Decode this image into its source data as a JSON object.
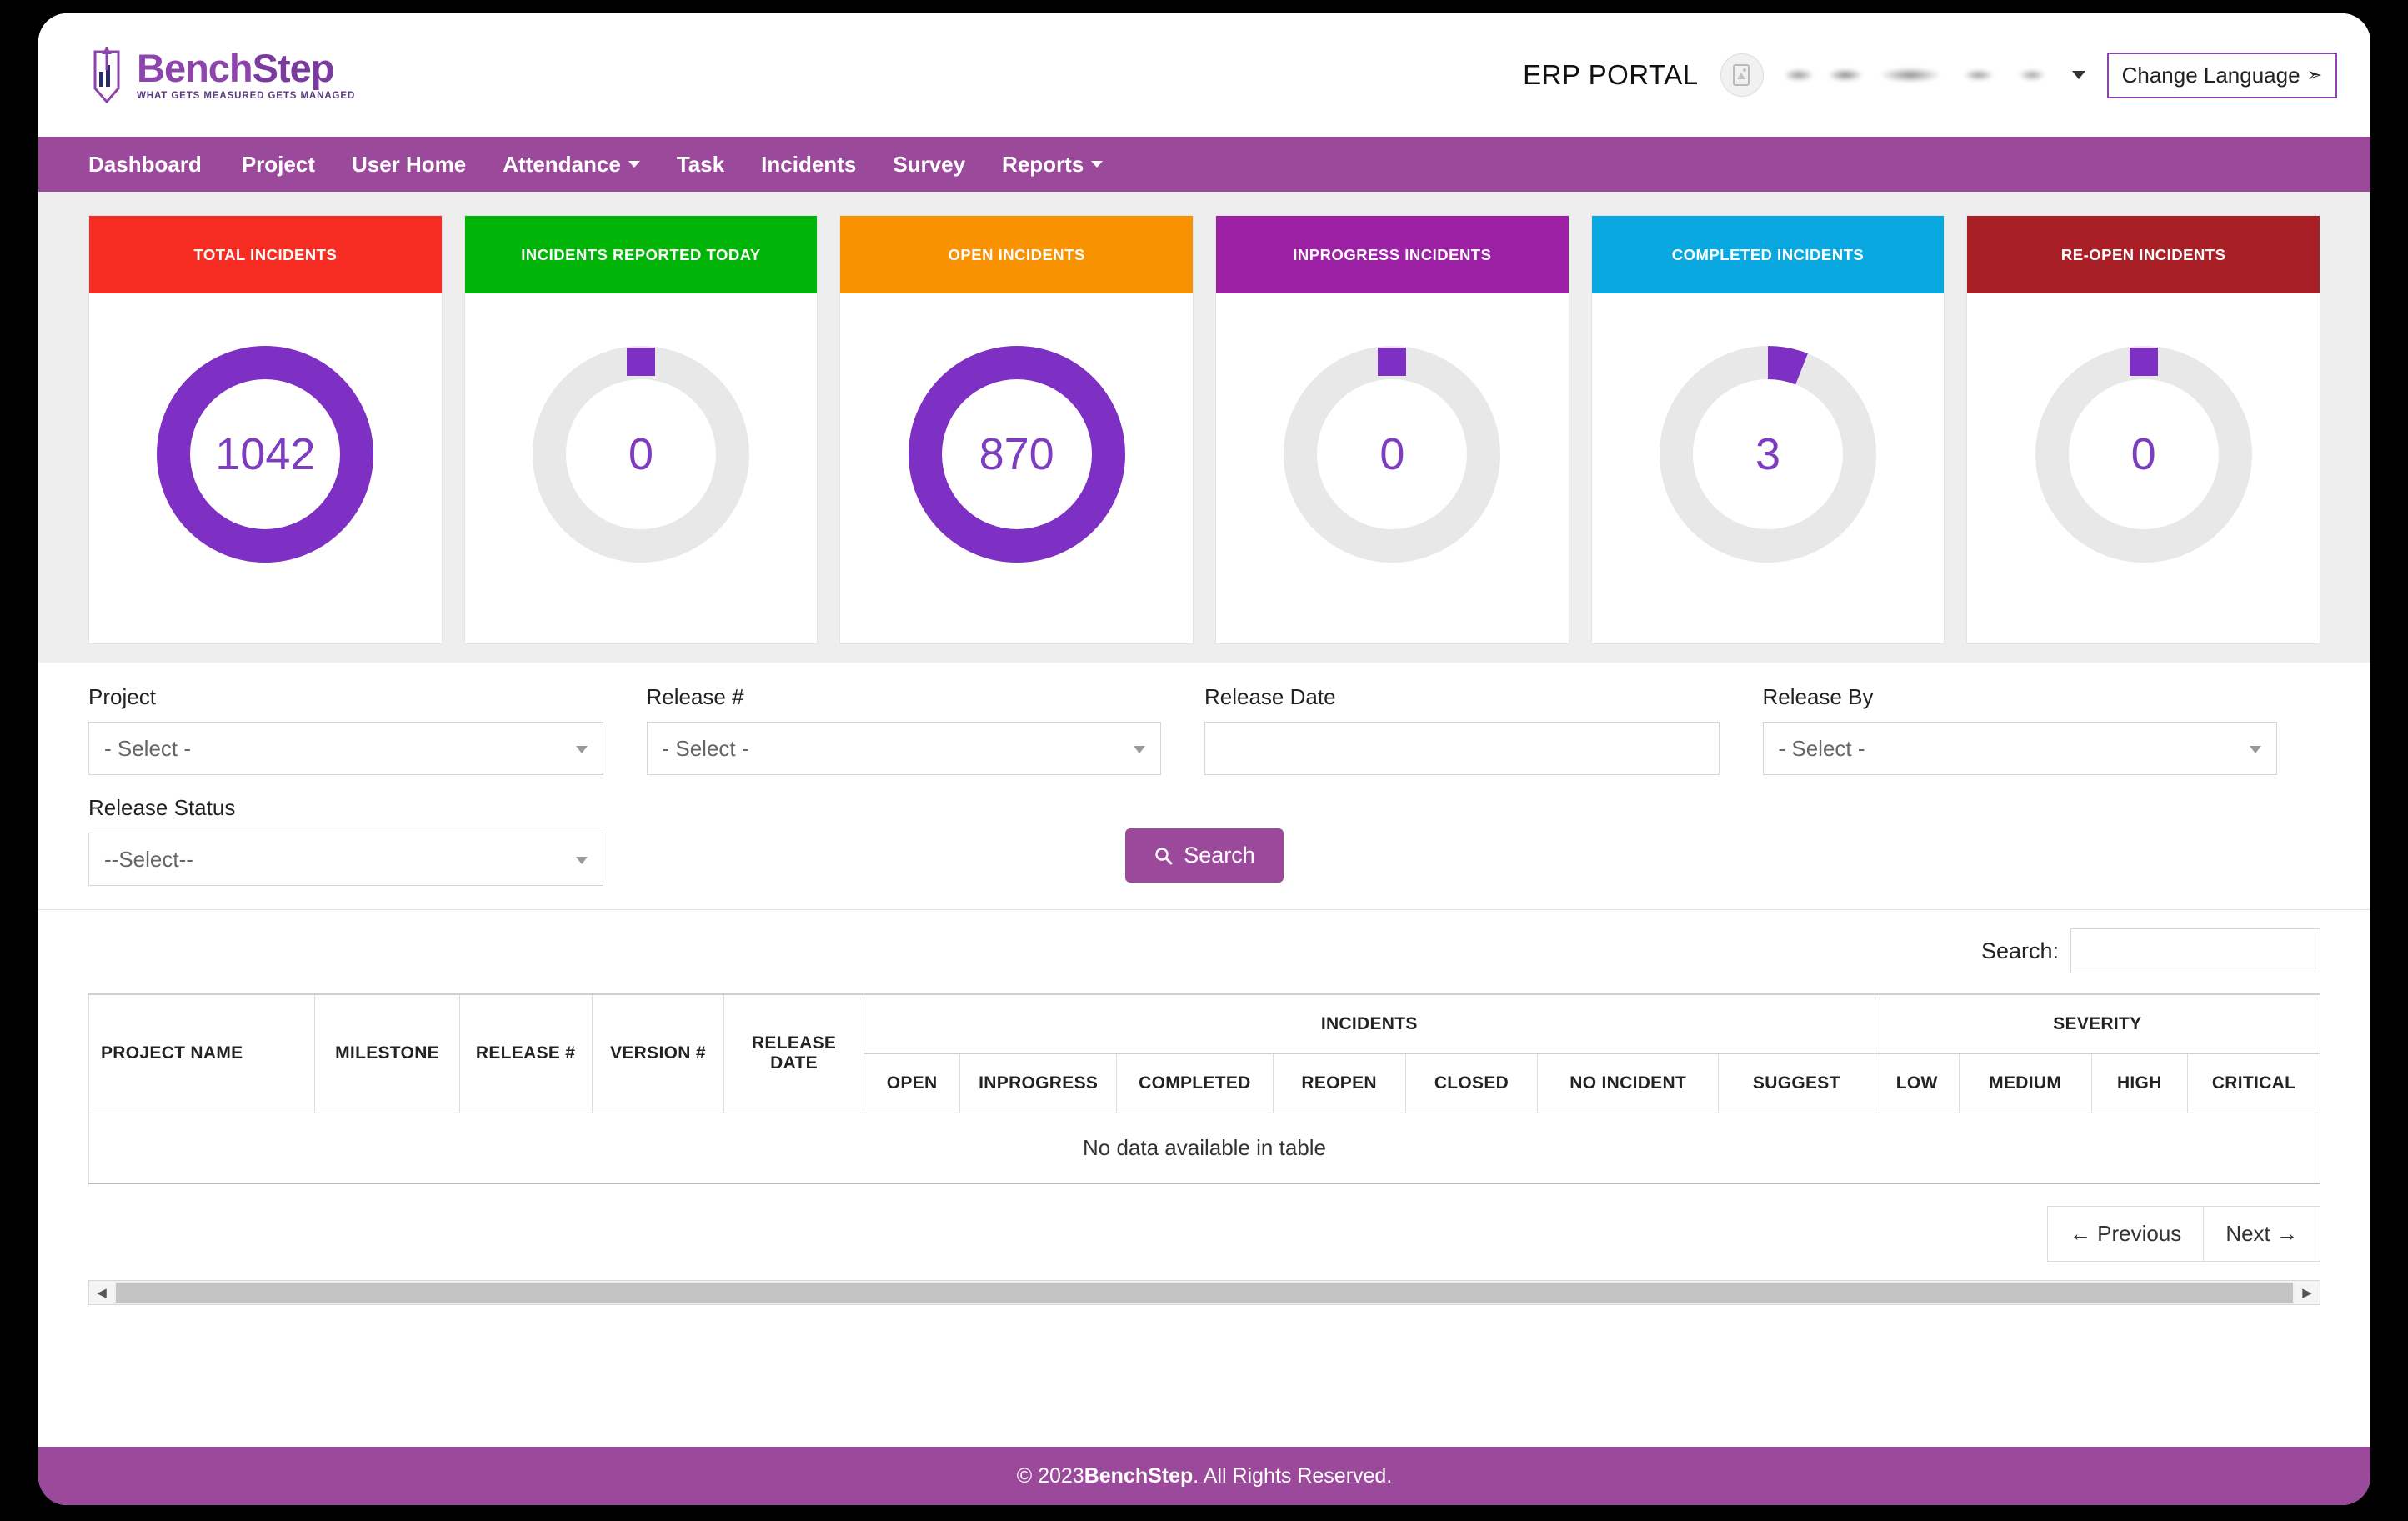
{
  "brand": {
    "name_part1": "Bench",
    "name_part2": "Step",
    "tagline": "WHAT GETS MEASURED GETS MANAGED",
    "logo_icon": "bar-chart-pen-logo-icon"
  },
  "header": {
    "portal_title": "ERP PORTAL",
    "avatar_icon": "user-avatar-icon",
    "user_email": "",
    "user_dropdown_icon": "caret-down-icon",
    "change_language_label": "Change Language",
    "change_language_chevron": "chevron-down-icon",
    "accent_color": "#8e44ad"
  },
  "nav": {
    "background": "#9b4a9b",
    "items": [
      {
        "label": "Dashboard",
        "has_caret": false
      },
      {
        "label": "Project",
        "has_caret": false
      },
      {
        "label": "User Home",
        "has_caret": false
      },
      {
        "label": "Attendance",
        "has_caret": true
      },
      {
        "label": "Task",
        "has_caret": false
      },
      {
        "label": "Incidents",
        "has_caret": false
      },
      {
        "label": "Survey",
        "has_caret": false
      },
      {
        "label": "Reports",
        "has_caret": true
      }
    ]
  },
  "chart_data": {
    "type": "pie",
    "title": "Incident KPI Donuts",
    "legend": "none",
    "ring_track_color": "#e8e8e8",
    "ring_value_color": "#7e2fc4",
    "cards": [
      {
        "label": "TOTAL INCIDENTS",
        "value": 1042,
        "percent": 100,
        "header_color": "#f72c22"
      },
      {
        "label": "INCIDENTS REPORTED TODAY",
        "value": 0,
        "percent": 0,
        "header_color": "#00b408"
      },
      {
        "label": "OPEN INCIDENTS",
        "value": 870,
        "percent": 100,
        "header_color": "#f99200"
      },
      {
        "label": "INPROGRESS INCIDENTS",
        "value": 0,
        "percent": 0,
        "header_color": "#9b20a4"
      },
      {
        "label": "COMPLETED INCIDENTS",
        "value": 3,
        "percent": 6,
        "header_color": "#0aa8e0"
      },
      {
        "label": "RE-OPEN INCIDENTS",
        "value": 0,
        "percent": 0,
        "header_color": "#a82025"
      }
    ]
  },
  "filters": {
    "project": {
      "label": "Project",
      "value": "- Select -"
    },
    "release_no": {
      "label": "Release #",
      "value": "- Select -"
    },
    "release_date": {
      "label": "Release Date",
      "value": "",
      "placeholder": ""
    },
    "release_by": {
      "label": "Release By",
      "value": "- Select -"
    },
    "release_status": {
      "label": "Release Status",
      "value": "--Select--"
    },
    "search_button": {
      "label": "Search",
      "icon": "magnifier-icon",
      "color": "#9b4a9b"
    }
  },
  "datatable": {
    "search_label": "Search:",
    "search_value": "",
    "search_placeholder": "",
    "group_headers": {
      "incidents": "INCIDENTS",
      "severity": "SEVERITY"
    },
    "base_columns": [
      "PROJECT NAME",
      "MILESTONE",
      "RELEASE #",
      "VERSION #",
      "RELEASE DATE"
    ],
    "incident_columns": [
      "OPEN",
      "INPROGRESS",
      "COMPLETED",
      "REOPEN",
      "CLOSED",
      "NO INCIDENT",
      "SUGGEST"
    ],
    "severity_columns": [
      "LOW",
      "MEDIUM",
      "HIGH",
      "CRITICAL"
    ],
    "rows": [],
    "empty_message": "No data available in table",
    "pagination": {
      "previous_label": "← Previous",
      "next_label": "Next →"
    },
    "scrollbar": {
      "left_arrow": "◀",
      "right_arrow": "▶"
    }
  },
  "footer": {
    "copyright_prefix": "© 2023 ",
    "brand": "BenchStep",
    "copyright_suffix": ". All Rights Reserved."
  }
}
